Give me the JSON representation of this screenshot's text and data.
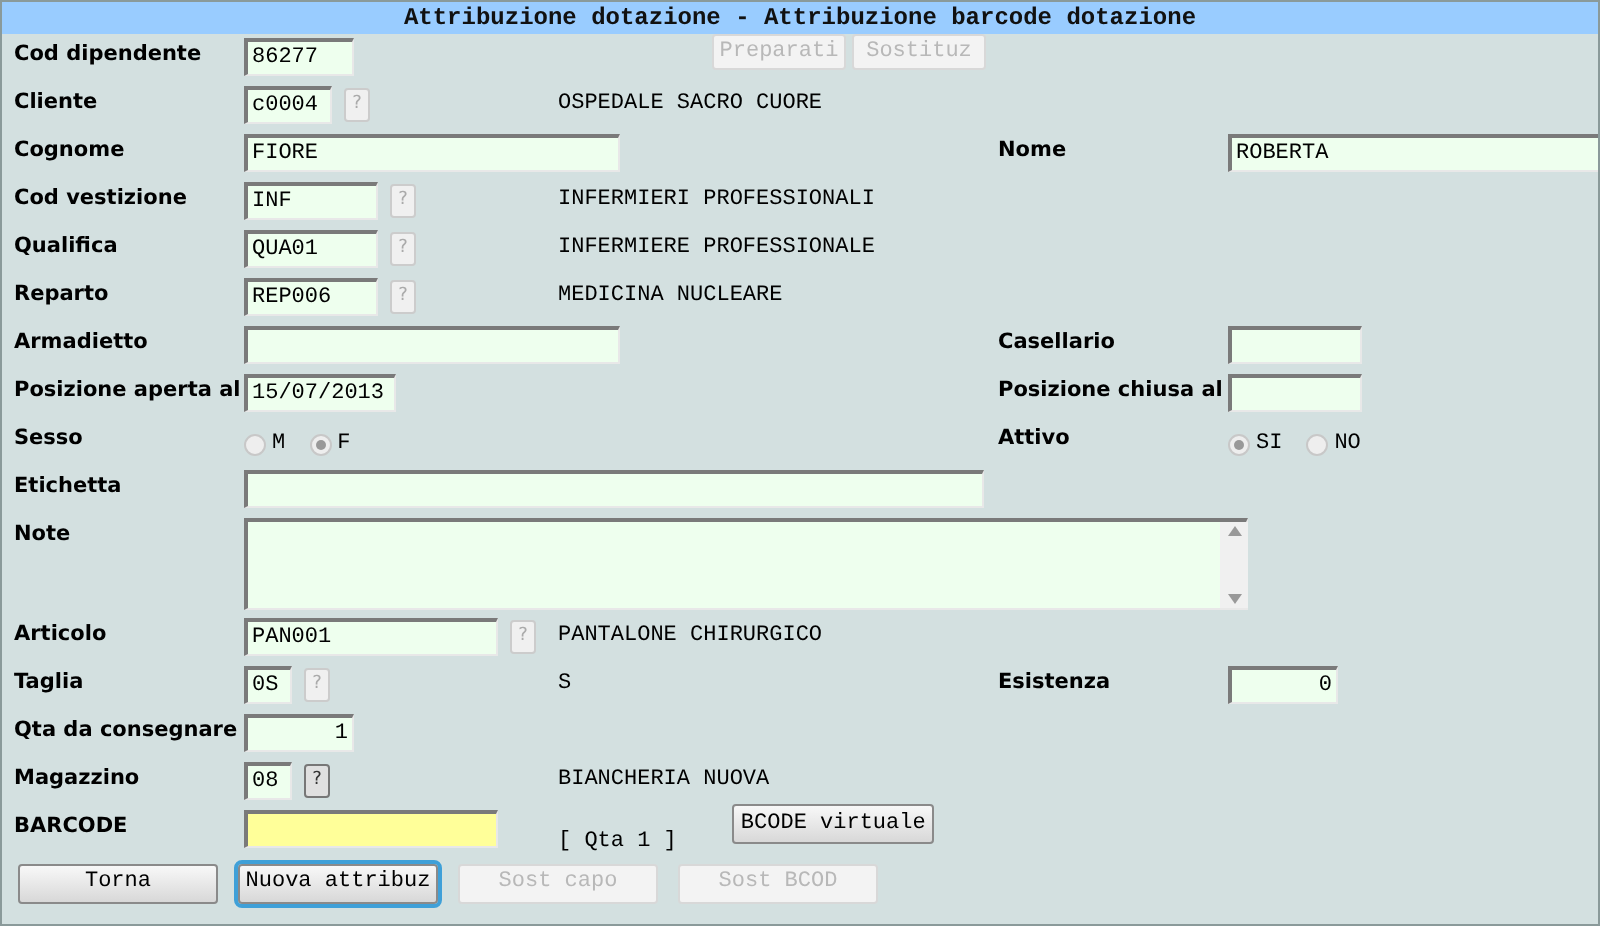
{
  "title": "Attribuzione dotazione - Attribuzione barcode dotazione",
  "top_buttons": [
    {
      "label": "Preparati",
      "disabled": true
    },
    {
      "label": "Sostituz",
      "disabled": true
    }
  ],
  "rows": [
    {
      "label": "Cod dipendente",
      "field": {
        "kind": "text",
        "value": "86277"
      }
    },
    {
      "label": "Cliente",
      "field": {
        "kind": "text",
        "value": "c0004"
      },
      "lookup": {
        "label": "?",
        "disabled": true
      },
      "description": "OSPEDALE SACRO CUORE"
    },
    {
      "label": "Cognome",
      "field": {
        "kind": "text",
        "value": "FIORE"
      },
      "right": {
        "label": "Nome",
        "field": {
          "kind": "text",
          "value": "ROBERTA"
        }
      }
    },
    {
      "label": "Cod vestizione",
      "field": {
        "kind": "text",
        "value": "INF"
      },
      "lookup": {
        "label": "?",
        "disabled": true
      },
      "description": "INFERMIERI PROFESSIONALI"
    },
    {
      "label": "Qualifica",
      "field": {
        "kind": "text",
        "value": "QUA01"
      },
      "lookup": {
        "label": "?",
        "disabled": true
      },
      "description": "INFERMIERE PROFESSIONALE"
    },
    {
      "label": "Reparto",
      "field": {
        "kind": "text",
        "value": "REP006"
      },
      "lookup": {
        "label": "?",
        "disabled": true
      },
      "description": "MEDICINA NUCLEARE"
    },
    {
      "label": "Armadietto",
      "field": {
        "kind": "text"
      },
      "right": {
        "label": "Casellario",
        "field": {
          "kind": "text"
        }
      }
    },
    {
      "label": "Posizione aperta al",
      "field": {
        "kind": "text",
        "value": "15/07/2013"
      },
      "right": {
        "label": "Posizione chiusa al",
        "field": {
          "kind": "text"
        }
      }
    },
    {
      "label": "Sesso",
      "radios": [
        {
          "label": "M",
          "selected": false
        },
        {
          "label": "F",
          "selected": true
        }
      ],
      "right": {
        "label": "Attivo",
        "radios": [
          {
            "label": "SI",
            "selected": true
          },
          {
            "label": "NO",
            "selected": false
          }
        ]
      }
    },
    {
      "label": "Etichetta",
      "field": {
        "kind": "text"
      }
    },
    {
      "label": "Note",
      "field": {
        "kind": "textarea"
      }
    },
    {
      "label": "Articolo",
      "field": {
        "kind": "text",
        "value": "PAN001"
      },
      "lookup": {
        "label": "?",
        "disabled": true
      },
      "description": "PANTALONE CHIRURGICO"
    },
    {
      "label": "Taglia",
      "field": {
        "kind": "text",
        "value": "0S"
      },
      "lookup": {
        "label": "?",
        "disabled": true
      },
      "description": "S",
      "right": {
        "label": "Esistenza",
        "field": {
          "kind": "number",
          "value": "0"
        }
      }
    },
    {
      "label": "Qta da consegnare",
      "field": {
        "kind": "number",
        "value": "1"
      }
    },
    {
      "label": "Magazzino",
      "field": {
        "kind": "text",
        "value": "08"
      },
      "lookup": {
        "label": "?",
        "disabled": false
      },
      "description": "BIANCHERIA NUOVA"
    },
    {
      "label": "BARCODE",
      "field": {
        "kind": "text",
        "focused": true
      },
      "note": "[ Qta 1 ]",
      "action": {
        "label": "BCODE virtuale",
        "disabled": false
      }
    }
  ],
  "bottom_buttons": [
    {
      "label": "Torna",
      "disabled": false,
      "focused": false
    },
    {
      "label": "Nuova attribuz",
      "disabled": false,
      "focused": true
    },
    {
      "label": "Sost capo",
      "disabled": true,
      "focused": false
    },
    {
      "label": "Sost BCOD",
      "disabled": true,
      "focused": false
    }
  ]
}
